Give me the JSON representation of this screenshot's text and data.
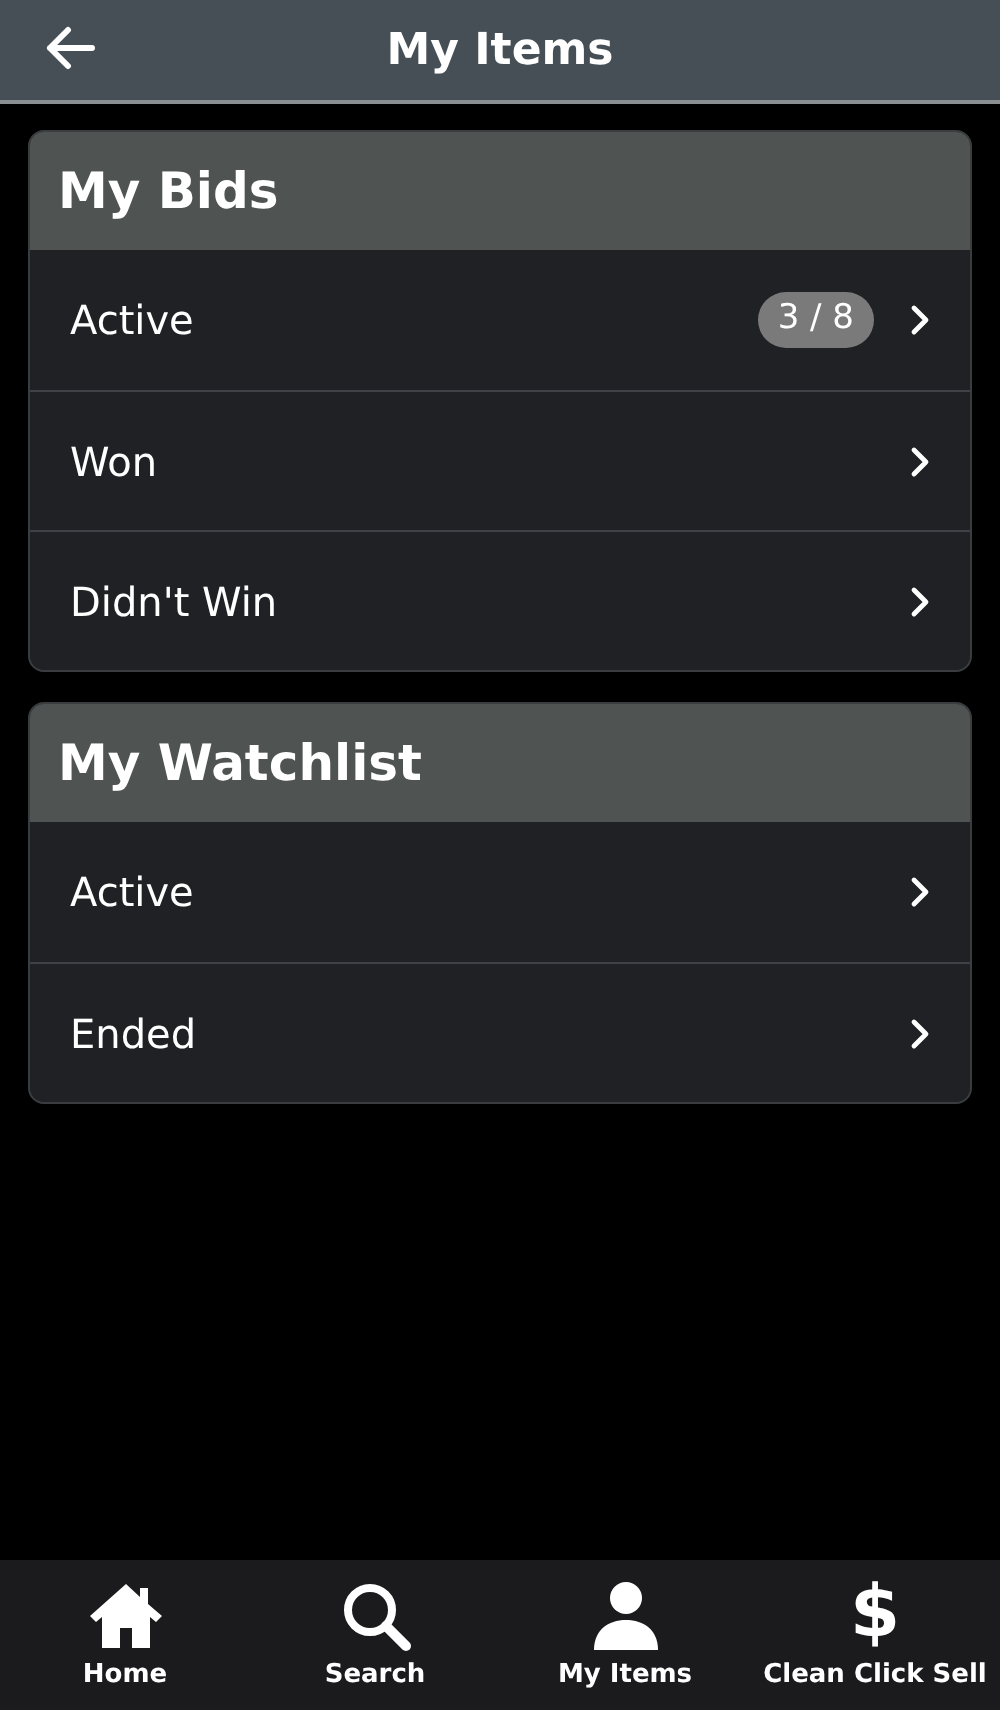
{
  "header": {
    "title": "My Items"
  },
  "sections": [
    {
      "title": "My Bids",
      "rows": [
        {
          "label": "Active",
          "badge": "3 / 8"
        },
        {
          "label": "Won"
        },
        {
          "label": "Didn't Win"
        }
      ]
    },
    {
      "title": "My Watchlist",
      "rows": [
        {
          "label": "Active"
        },
        {
          "label": "Ended"
        }
      ]
    }
  ],
  "bottom_nav": [
    {
      "kind": "home",
      "label": "Home"
    },
    {
      "kind": "search",
      "label": "Search"
    },
    {
      "kind": "person",
      "label": "My Items"
    },
    {
      "kind": "glyph",
      "glyph": "$",
      "label": "Clean Click Sell"
    }
  ]
}
